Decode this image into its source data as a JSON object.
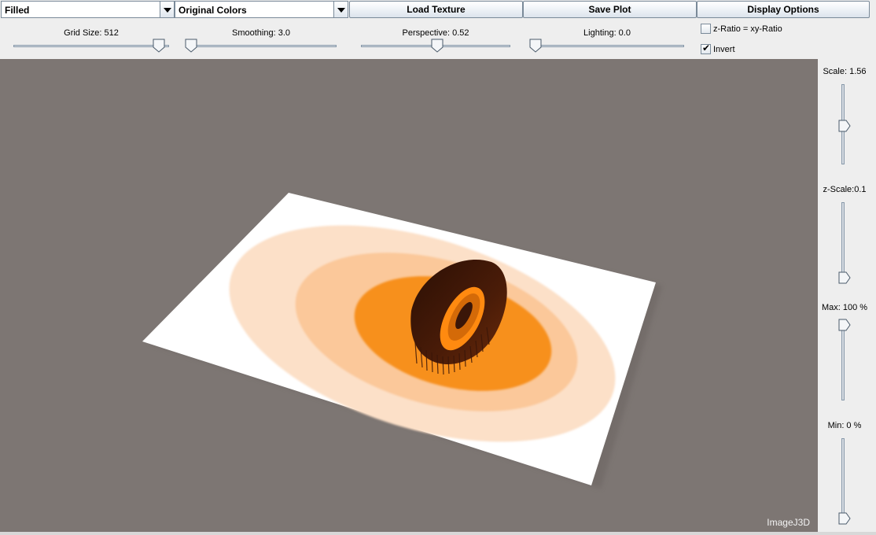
{
  "toolbar": {
    "render_mode": {
      "value": "Filled"
    },
    "color_mode": {
      "value": "Original Colors"
    },
    "load_texture_label": "Load Texture",
    "save_plot_label": "Save Plot",
    "display_options_label": "Display Options"
  },
  "sliders": {
    "grid_size": {
      "label": "Grid Size: 512",
      "level": 0.98
    },
    "smoothing": {
      "label": "Smoothing: 3.0",
      "level": 0.0
    },
    "perspective": {
      "label": "Perspective: 0.52",
      "level": 0.52
    },
    "lighting": {
      "label": "Lighting: 0.0",
      "level": 0.0
    }
  },
  "checkboxes": {
    "z_ratio": {
      "label": "z-Ratio = xy-Ratio",
      "checked": false
    },
    "invert": {
      "label": "Invert",
      "checked": true,
      "mark": "✔"
    }
  },
  "right_panel": {
    "scale": {
      "label": "Scale: 1.56",
      "level": 0.48
    },
    "z_scale": {
      "label": "z-Scale:0.1",
      "level": 0.0
    },
    "max": {
      "label": "Max: 100 %",
      "level": 1.0
    },
    "min": {
      "label": "Min: 0 %",
      "level": 0.0
    }
  },
  "plot": {
    "watermark": "ImageJ3D",
    "background_color": "#7d7673",
    "colors": {
      "plane": "#ffffff",
      "outer_ring": "#fce0c8",
      "middle_ring": "#fbc89a",
      "inner_disc": "#f7901e",
      "peak": "#3a1608",
      "highlight": "#ff8a10"
    }
  }
}
